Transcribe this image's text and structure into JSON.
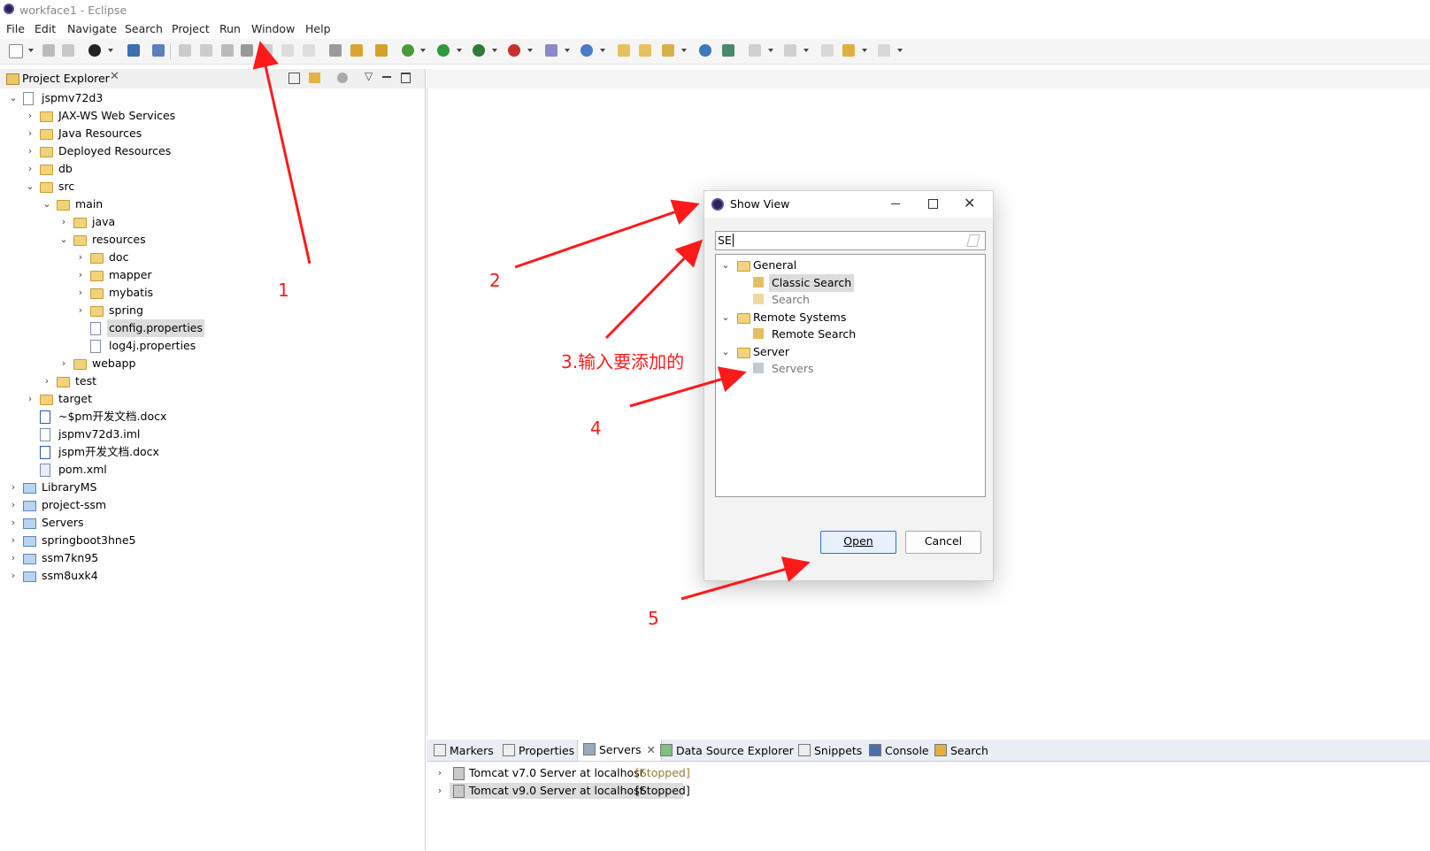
{
  "window": {
    "title": "workface1 - Eclipse"
  },
  "menu": [
    "File",
    "Edit",
    "Navigate",
    "Search",
    "Project",
    "Run",
    "Window",
    "Help"
  ],
  "project_explorer": {
    "tab_label": "Project Explorer",
    "tree": [
      {
        "label": "jspmv72d3",
        "depth": 0,
        "expanded": true,
        "icon": "project-icon"
      },
      {
        "label": "JAX-WS Web Services",
        "depth": 1,
        "expanded": false,
        "icon": "webservice-icon"
      },
      {
        "label": "Java Resources",
        "depth": 1,
        "expanded": false,
        "icon": "java-resources-icon"
      },
      {
        "label": "Deployed Resources",
        "depth": 1,
        "expanded": false,
        "icon": "deployed-icon"
      },
      {
        "label": "db",
        "depth": 1,
        "expanded": false,
        "icon": "folder-icon"
      },
      {
        "label": "src",
        "depth": 1,
        "expanded": true,
        "icon": "folder-icon"
      },
      {
        "label": "main",
        "depth": 2,
        "expanded": true,
        "icon": "folder-icon"
      },
      {
        "label": "java",
        "depth": 3,
        "expanded": false,
        "icon": "folder-icon"
      },
      {
        "label": "resources",
        "depth": 3,
        "expanded": true,
        "icon": "folder-icon"
      },
      {
        "label": "doc",
        "depth": 4,
        "expanded": false,
        "icon": "folder-icon"
      },
      {
        "label": "mapper",
        "depth": 4,
        "expanded": false,
        "icon": "folder-icon"
      },
      {
        "label": "mybatis",
        "depth": 4,
        "expanded": false,
        "icon": "folder-icon"
      },
      {
        "label": "spring",
        "depth": 4,
        "expanded": false,
        "icon": "folder-icon"
      },
      {
        "label": "config.properties",
        "depth": 4,
        "leaf": true,
        "selected": true,
        "icon": "file-icon"
      },
      {
        "label": "log4j.properties",
        "depth": 4,
        "leaf": true,
        "icon": "file-icon"
      },
      {
        "label": "webapp",
        "depth": 3,
        "expanded": false,
        "icon": "folder-icon"
      },
      {
        "label": "test",
        "depth": 2,
        "expanded": false,
        "icon": "folder-icon"
      },
      {
        "label": "target",
        "depth": 1,
        "expanded": false,
        "icon": "folder-icon"
      },
      {
        "label": "~$pm开发文档.docx",
        "depth": 1,
        "leaf": true,
        "icon": "docx-icon"
      },
      {
        "label": "jspmv72d3.iml",
        "depth": 1,
        "leaf": true,
        "icon": "file-icon"
      },
      {
        "label": "jspm开发文档.docx",
        "depth": 1,
        "leaf": true,
        "icon": "docx-icon"
      },
      {
        "label": "pom.xml",
        "depth": 1,
        "leaf": true,
        "icon": "maven-icon"
      },
      {
        "label": "LibraryMS",
        "depth": 0,
        "expanded": false,
        "icon": "project-folder-icon"
      },
      {
        "label": "project-ssm",
        "depth": 0,
        "expanded": false,
        "icon": "project-folder-icon"
      },
      {
        "label": "Servers",
        "depth": 0,
        "expanded": false,
        "icon": "project-folder-icon"
      },
      {
        "label": "springboot3hne5",
        "depth": 0,
        "expanded": false,
        "icon": "project-folder-icon"
      },
      {
        "label": "ssm7kn95",
        "depth": 0,
        "expanded": false,
        "icon": "project-folder-icon"
      },
      {
        "label": "ssm8uxk4",
        "depth": 0,
        "expanded": false,
        "icon": "project-folder-icon"
      }
    ]
  },
  "dialog": {
    "title": "Show View",
    "search_value": "SE",
    "tree": [
      {
        "label": "General",
        "type": "category"
      },
      {
        "label": "Classic Search",
        "type": "item",
        "selected": true
      },
      {
        "label": "Search",
        "type": "item",
        "dim": true
      },
      {
        "label": "Remote Systems",
        "type": "category"
      },
      {
        "label": "Remote Search",
        "type": "item"
      },
      {
        "label": "Server",
        "type": "category"
      },
      {
        "label": "Servers",
        "type": "item",
        "dim": true
      }
    ],
    "open_label": "Open",
    "cancel_label": "Cancel"
  },
  "bottom_panel": {
    "tabs": [
      "Markers",
      "Properties",
      "Servers",
      "Data Source Explorer",
      "Snippets",
      "Console",
      "Search"
    ],
    "active_tab": "Servers",
    "servers": [
      {
        "name": "Tomcat v7.0 Server at localhost",
        "status": "[Stopped]"
      },
      {
        "name": "Tomcat v9.0 Server at localhost",
        "status": "[Stopped]",
        "selected": true
      }
    ]
  },
  "annotations": [
    "1",
    "2",
    "3.输入要添加的",
    "4",
    "5"
  ],
  "colors": {
    "annotation": "#ff1a1a",
    "selection": "#dcdcdc",
    "status_stopped": "#9a7a3a"
  }
}
